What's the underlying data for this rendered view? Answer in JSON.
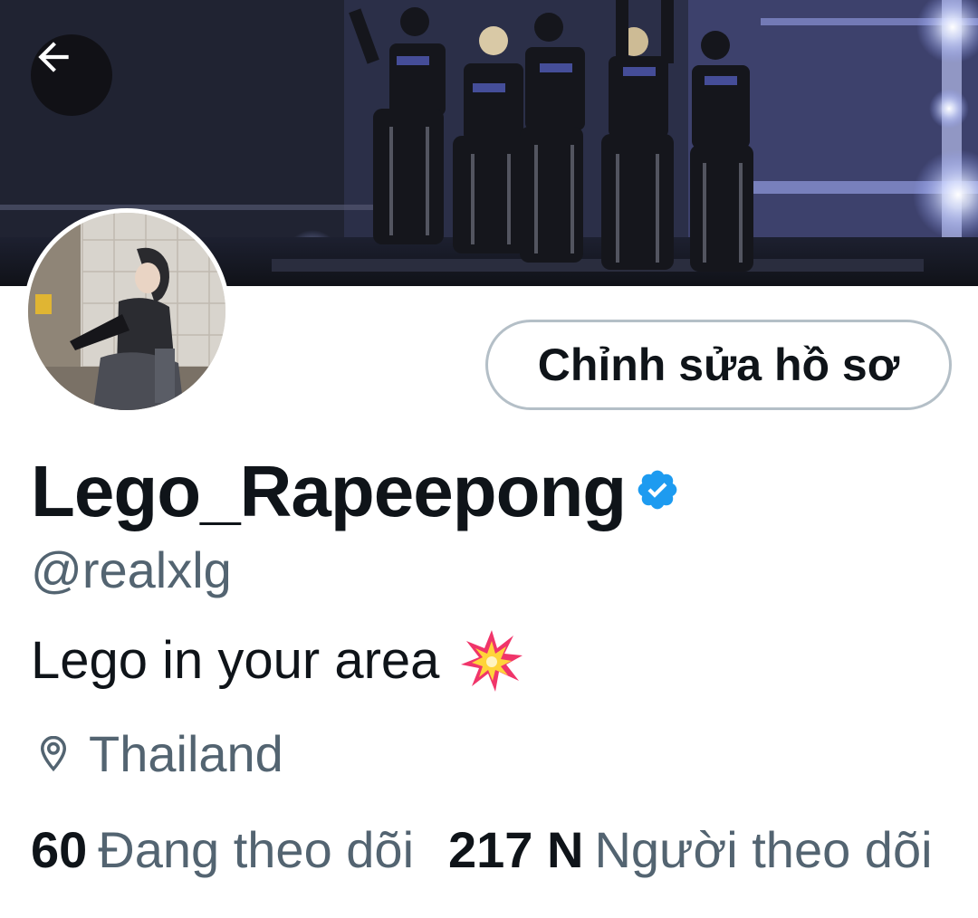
{
  "header": {
    "banner_image": "concert-stage-banner-photo",
    "back_icon": "arrow-left-icon"
  },
  "profile": {
    "avatar_image": "profile-avatar-photo",
    "edit_button_label": "Chỉnh sửa hồ sơ",
    "display_name": "Lego_Rapeepong",
    "verified_icon": "verified-badge-icon",
    "verified_color": "#1d9bf0",
    "handle": "@realxlg",
    "bio_text": "Lego in your area",
    "bio_emoji": "collision-emoji-icon",
    "location_icon": "location-pin-icon",
    "location": "Thailand"
  },
  "stats": {
    "following_count": "60",
    "following_label": "Đang theo dõi",
    "followers_count": "217 N",
    "followers_label": "Người theo dõi"
  },
  "colors": {
    "text_primary": "#0f1419",
    "text_secondary": "#536471",
    "button_border": "#b4bfc7"
  }
}
